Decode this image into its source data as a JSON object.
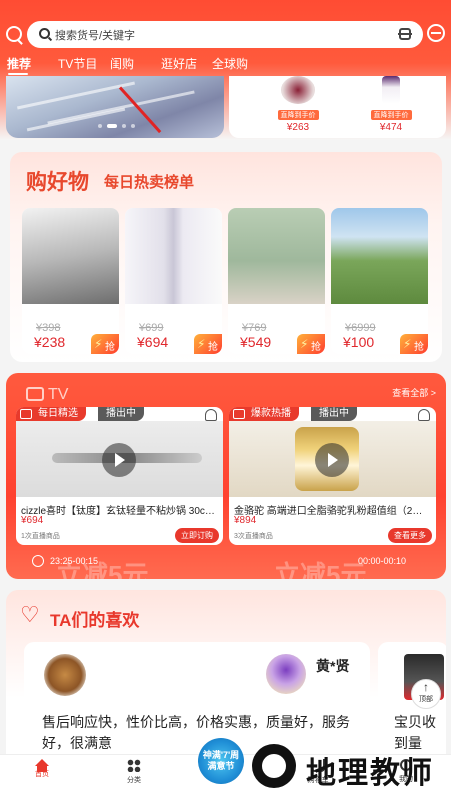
{
  "search": {
    "placeholder": "搜索货号/关键字"
  },
  "tabs": [
    {
      "label": "推荐"
    },
    {
      "label": "TV节目"
    },
    {
      "label": "闺购"
    },
    {
      "label": "逛好店"
    },
    {
      "label": "全球购"
    }
  ],
  "banner": {
    "page_count": 4,
    "active_page": 1
  },
  "mini_products": [
    {
      "tag": "直降到手价",
      "price": "¥263"
    },
    {
      "tag": "直降到手价",
      "price": "¥474"
    }
  ],
  "goodwu": {
    "title": "购好物",
    "subtitle": "每日热卖榜单",
    "items": [
      {
        "old_price": "¥398",
        "price": "¥238",
        "badge": "抢",
        "color": "#8b8b8b"
      },
      {
        "old_price": "¥699",
        "price": "¥694",
        "badge": "抢",
        "color": "#e6e4ec"
      },
      {
        "old_price": "¥769",
        "price": "¥549",
        "badge": "抢",
        "color": "#9cb89a"
      },
      {
        "old_price": "¥6999",
        "price": "¥100",
        "badge": "抢",
        "color": "#7da85a"
      }
    ]
  },
  "tv": {
    "label": "TV",
    "view_all": "查看全部 >",
    "panels": [
      {
        "chip": "每日精选",
        "status": "播出中",
        "name": "cizzle喜时【钛度】玄钛轻量不粘炒锅 30c…",
        "price": "¥694",
        "count": "1次直播商品",
        "button": "立即订购"
      },
      {
        "chip": "爆款热播",
        "status": "播出中",
        "name": "金骆驼 高端进口全脂骆驼乳粉超值组（2…",
        "price": "¥894",
        "count": "3次直播商品",
        "button": "查看更多"
      }
    ],
    "time_left": "23:25-00:15",
    "time_right": "00:00-00:10",
    "promo_big": "立减5元"
  },
  "likes": {
    "title": "TA们的喜欢",
    "review": {
      "user": "黄*贤",
      "text": "售后响应快，性价比高，价格实惠，质量好，服务好，很满意"
    },
    "review2": {
      "text": "宝贝收到量好，，"
    }
  },
  "back_top": {
    "label": "顶部"
  },
  "promo_bubble": {
    "text": "神满'7'周 满意节"
  },
  "bottom_nav": [
    {
      "label": "首页"
    },
    {
      "label": "分类"
    },
    {
      "label": "购物车"
    },
    {
      "label": "我的"
    }
  ],
  "watermark": {
    "text": "地理教师"
  },
  "colors": {
    "brand": "#ff4c33",
    "price": "#e0282d"
  }
}
